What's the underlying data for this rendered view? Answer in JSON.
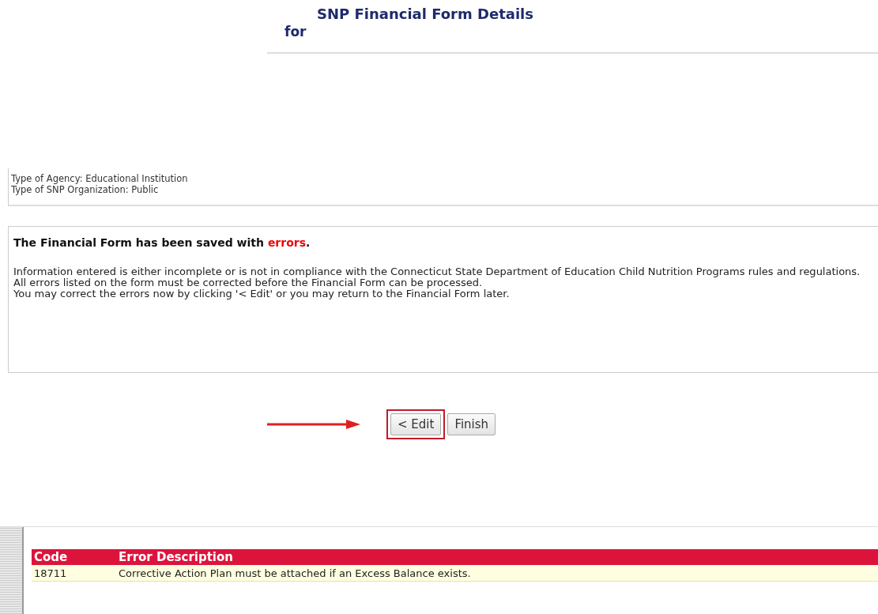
{
  "header": {
    "title": "SNP Financial Form Details",
    "subtitle": "for"
  },
  "agency_info": [
    "Type of Agency: Educational Institution",
    "Type of SNP Organization: Public"
  ],
  "message": {
    "heading": {
      "before": "The Financial Form has been saved with",
      "highlight": "errors",
      "after": "."
    },
    "paragraphs": [
      "Information entered is either incomplete or is not in compliance with the Connecticut State Department of Education Child Nutrition Programs rules and regulations. All errors listed on the form must be corrected before the Financial Form can be processed.",
      "You may correct the errors now by clicking '< Edit' or you may return to the Financial Form later."
    ]
  },
  "buttons": [
    {
      "label": "< Edit",
      "highlighted": true
    },
    {
      "label": "Finish",
      "highlighted": false
    }
  ],
  "errors_table": {
    "columns": [
      "Code",
      "Error Description"
    ],
    "rows": [
      [
        "18711",
        "Corrective Action Plan must be attached if an Excess Balance exists."
      ]
    ]
  }
}
